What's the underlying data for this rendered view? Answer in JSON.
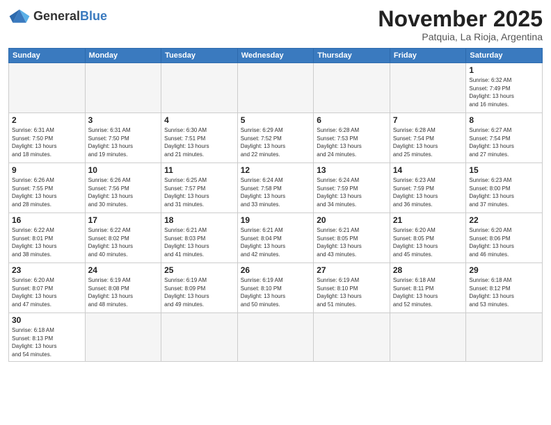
{
  "header": {
    "logo_general": "General",
    "logo_blue": "Blue",
    "month_title": "November 2025",
    "location": "Patquia, La Rioja, Argentina"
  },
  "days_of_week": [
    "Sunday",
    "Monday",
    "Tuesday",
    "Wednesday",
    "Thursday",
    "Friday",
    "Saturday"
  ],
  "cells": [
    {
      "day": "",
      "info": "",
      "empty": true
    },
    {
      "day": "",
      "info": "",
      "empty": true
    },
    {
      "day": "",
      "info": "",
      "empty": true
    },
    {
      "day": "",
      "info": "",
      "empty": true
    },
    {
      "day": "",
      "info": "",
      "empty": true
    },
    {
      "day": "",
      "info": "",
      "empty": true
    },
    {
      "day": "1",
      "info": "Sunrise: 6:32 AM\nSunset: 7:49 PM\nDaylight: 13 hours\nand 16 minutes.",
      "empty": false
    },
    {
      "day": "2",
      "info": "Sunrise: 6:31 AM\nSunset: 7:50 PM\nDaylight: 13 hours\nand 18 minutes.",
      "empty": false
    },
    {
      "day": "3",
      "info": "Sunrise: 6:31 AM\nSunset: 7:50 PM\nDaylight: 13 hours\nand 19 minutes.",
      "empty": false
    },
    {
      "day": "4",
      "info": "Sunrise: 6:30 AM\nSunset: 7:51 PM\nDaylight: 13 hours\nand 21 minutes.",
      "empty": false
    },
    {
      "day": "5",
      "info": "Sunrise: 6:29 AM\nSunset: 7:52 PM\nDaylight: 13 hours\nand 22 minutes.",
      "empty": false
    },
    {
      "day": "6",
      "info": "Sunrise: 6:28 AM\nSunset: 7:53 PM\nDaylight: 13 hours\nand 24 minutes.",
      "empty": false
    },
    {
      "day": "7",
      "info": "Sunrise: 6:28 AM\nSunset: 7:54 PM\nDaylight: 13 hours\nand 25 minutes.",
      "empty": false
    },
    {
      "day": "8",
      "info": "Sunrise: 6:27 AM\nSunset: 7:54 PM\nDaylight: 13 hours\nand 27 minutes.",
      "empty": false
    },
    {
      "day": "9",
      "info": "Sunrise: 6:26 AM\nSunset: 7:55 PM\nDaylight: 13 hours\nand 28 minutes.",
      "empty": false
    },
    {
      "day": "10",
      "info": "Sunrise: 6:26 AM\nSunset: 7:56 PM\nDaylight: 13 hours\nand 30 minutes.",
      "empty": false
    },
    {
      "day": "11",
      "info": "Sunrise: 6:25 AM\nSunset: 7:57 PM\nDaylight: 13 hours\nand 31 minutes.",
      "empty": false
    },
    {
      "day": "12",
      "info": "Sunrise: 6:24 AM\nSunset: 7:58 PM\nDaylight: 13 hours\nand 33 minutes.",
      "empty": false
    },
    {
      "day": "13",
      "info": "Sunrise: 6:24 AM\nSunset: 7:59 PM\nDaylight: 13 hours\nand 34 minutes.",
      "empty": false
    },
    {
      "day": "14",
      "info": "Sunrise: 6:23 AM\nSunset: 7:59 PM\nDaylight: 13 hours\nand 36 minutes.",
      "empty": false
    },
    {
      "day": "15",
      "info": "Sunrise: 6:23 AM\nSunset: 8:00 PM\nDaylight: 13 hours\nand 37 minutes.",
      "empty": false
    },
    {
      "day": "16",
      "info": "Sunrise: 6:22 AM\nSunset: 8:01 PM\nDaylight: 13 hours\nand 38 minutes.",
      "empty": false
    },
    {
      "day": "17",
      "info": "Sunrise: 6:22 AM\nSunset: 8:02 PM\nDaylight: 13 hours\nand 40 minutes.",
      "empty": false
    },
    {
      "day": "18",
      "info": "Sunrise: 6:21 AM\nSunset: 8:03 PM\nDaylight: 13 hours\nand 41 minutes.",
      "empty": false
    },
    {
      "day": "19",
      "info": "Sunrise: 6:21 AM\nSunset: 8:04 PM\nDaylight: 13 hours\nand 42 minutes.",
      "empty": false
    },
    {
      "day": "20",
      "info": "Sunrise: 6:21 AM\nSunset: 8:05 PM\nDaylight: 13 hours\nand 43 minutes.",
      "empty": false
    },
    {
      "day": "21",
      "info": "Sunrise: 6:20 AM\nSunset: 8:05 PM\nDaylight: 13 hours\nand 45 minutes.",
      "empty": false
    },
    {
      "day": "22",
      "info": "Sunrise: 6:20 AM\nSunset: 8:06 PM\nDaylight: 13 hours\nand 46 minutes.",
      "empty": false
    },
    {
      "day": "23",
      "info": "Sunrise: 6:20 AM\nSunset: 8:07 PM\nDaylight: 13 hours\nand 47 minutes.",
      "empty": false
    },
    {
      "day": "24",
      "info": "Sunrise: 6:19 AM\nSunset: 8:08 PM\nDaylight: 13 hours\nand 48 minutes.",
      "empty": false
    },
    {
      "day": "25",
      "info": "Sunrise: 6:19 AM\nSunset: 8:09 PM\nDaylight: 13 hours\nand 49 minutes.",
      "empty": false
    },
    {
      "day": "26",
      "info": "Sunrise: 6:19 AM\nSunset: 8:10 PM\nDaylight: 13 hours\nand 50 minutes.",
      "empty": false
    },
    {
      "day": "27",
      "info": "Sunrise: 6:19 AM\nSunset: 8:10 PM\nDaylight: 13 hours\nand 51 minutes.",
      "empty": false
    },
    {
      "day": "28",
      "info": "Sunrise: 6:18 AM\nSunset: 8:11 PM\nDaylight: 13 hours\nand 52 minutes.",
      "empty": false
    },
    {
      "day": "29",
      "info": "Sunrise: 6:18 AM\nSunset: 8:12 PM\nDaylight: 13 hours\nand 53 minutes.",
      "empty": false
    },
    {
      "day": "30",
      "info": "Sunrise: 6:18 AM\nSunset: 8:13 PM\nDaylight: 13 hours\nand 54 minutes.",
      "empty": false
    },
    {
      "day": "",
      "info": "",
      "empty": true
    },
    {
      "day": "",
      "info": "",
      "empty": true
    },
    {
      "day": "",
      "info": "",
      "empty": true
    },
    {
      "day": "",
      "info": "",
      "empty": true
    },
    {
      "day": "",
      "info": "",
      "empty": true
    },
    {
      "day": "",
      "info": "",
      "empty": true
    }
  ]
}
